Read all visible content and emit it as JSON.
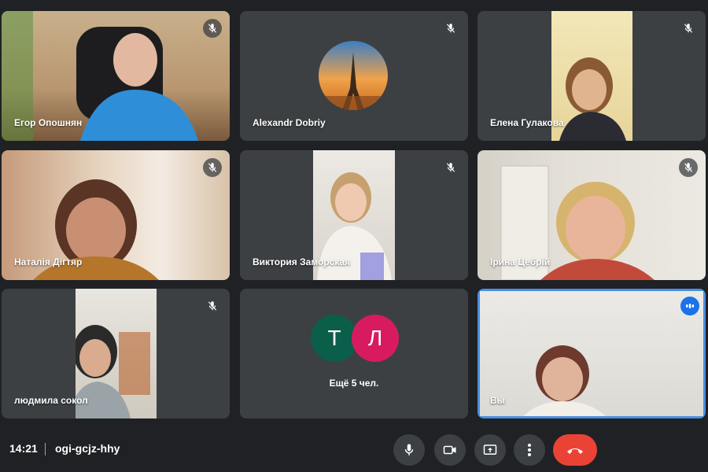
{
  "participants": [
    {
      "name": "Егор Опошнян",
      "muted": true
    },
    {
      "name": "Alexandr Dobriy",
      "muted": true
    },
    {
      "name": "Елена Гулакова",
      "muted": true
    },
    {
      "name": "Наталія Дігтяр",
      "muted": true
    },
    {
      "name": "Виктория Заморская",
      "muted": true
    },
    {
      "name": "Ірина Цебрій",
      "muted": true
    },
    {
      "name": "людмила сокол",
      "muted": true
    }
  ],
  "others_tile": {
    "avatars": [
      {
        "letter": "Т",
        "color": "#0b5e4a"
      },
      {
        "letter": "Л",
        "color": "#d81b60"
      }
    ],
    "label": "Ещё 5 чел."
  },
  "self_tile": {
    "name": "Вы",
    "speaking": true,
    "highlight_color": "#1a73e8"
  },
  "bottom_bar": {
    "time": "14:21",
    "meeting_code": "ogi-gcjz-hhy",
    "controls": [
      "mic-icon",
      "camera-icon",
      "present-screen-icon",
      "more-options-icon",
      "hang-up-icon"
    ],
    "hangup_color": "#ea4335"
  }
}
